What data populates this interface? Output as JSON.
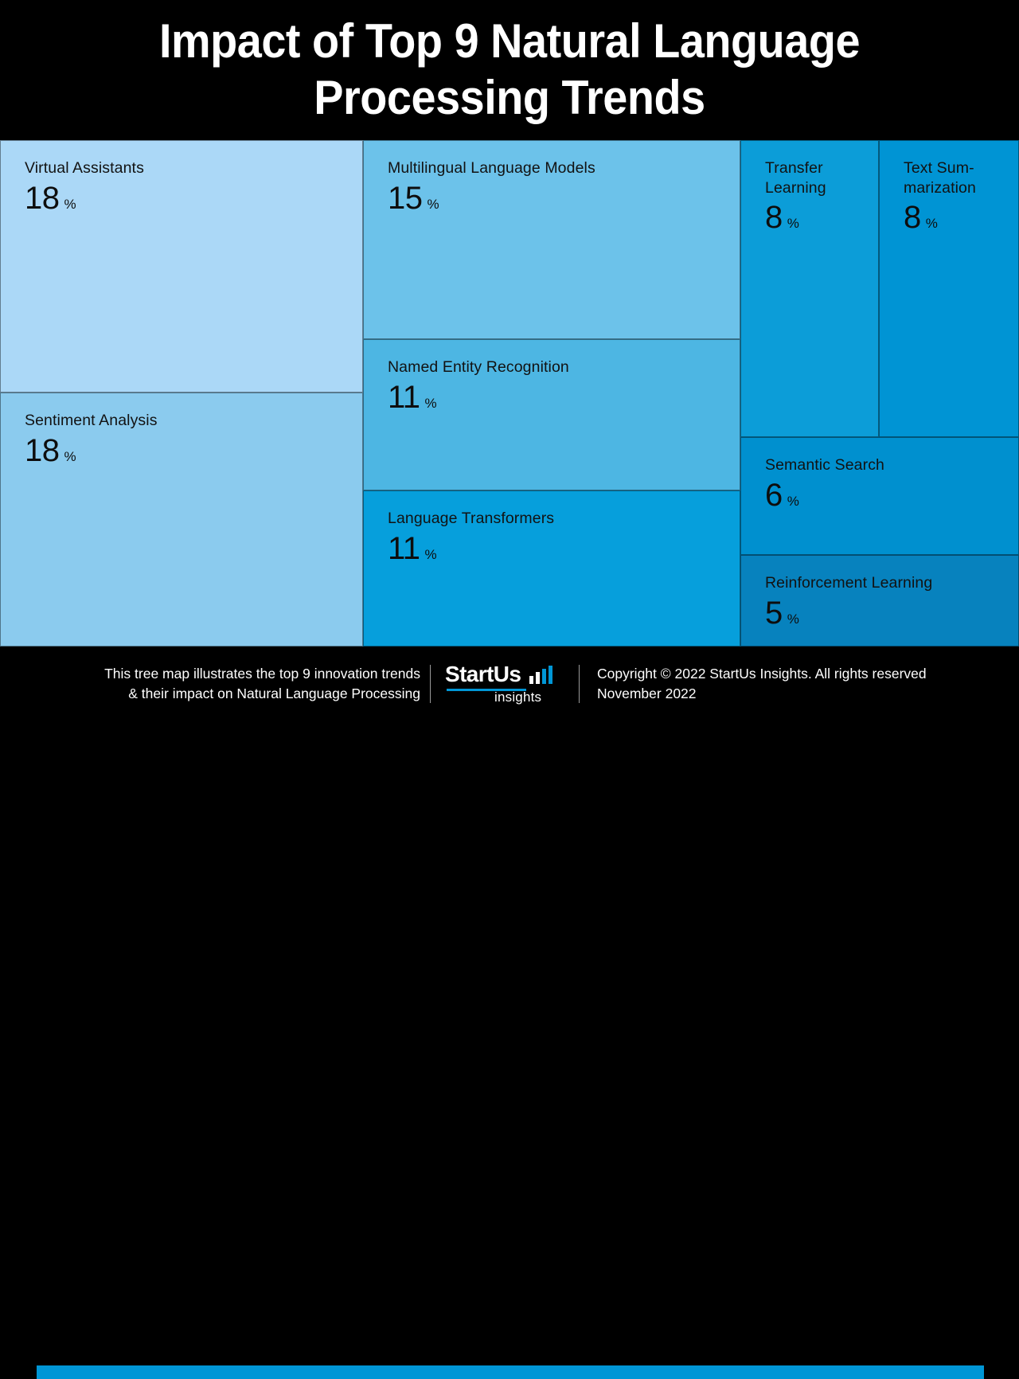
{
  "header": {
    "title": "Impact of Top 9 Natural Language\nProcessing Trends"
  },
  "footer": {
    "caption": "This tree map illustrates the top 9 innovation trends\n& their impact on Natural Language Processing",
    "copyright": "Copyright © 2022 StartUs Insights. All rights reserved\nNovember 2022",
    "logo_word": "StartUs",
    "logo_sub": "insights"
  },
  "unit": "%",
  "chart_data": {
    "type": "treemap",
    "title": "Impact of Top 9 Natural Language Processing Trends",
    "xlabel": "",
    "ylabel": "",
    "unit": "%",
    "legend": "none",
    "grid": false,
    "categories": [
      "Virtual Assistants",
      "Sentiment Analysis",
      "Multilingual Language Models",
      "Named Entity Recognition",
      "Language Transformers",
      "Transfer Learning",
      "Text Summarization",
      "Semantic Search",
      "Reinforcement Learning"
    ],
    "values": [
      18,
      18,
      15,
      11,
      11,
      8,
      8,
      6,
      5
    ],
    "cells": [
      {
        "label": "Virtual Assistants",
        "display_label": "Virtual Assistants",
        "value": 18,
        "color": "#ABD8F7"
      },
      {
        "label": "Sentiment Analysis",
        "display_label": "Sentiment Analysis",
        "value": 18,
        "color": "#8BCBEE"
      },
      {
        "label": "Multilingual Language Models",
        "display_label": "Multilingual Language Models",
        "value": 15,
        "color": "#6CC2EA"
      },
      {
        "label": "Named Entity Recognition",
        "display_label": "Named Entity Recognition",
        "value": 11,
        "color": "#4DB6E3"
      },
      {
        "label": "Language Transformers",
        "display_label": "Language Transformers",
        "value": 11,
        "color": "#069FDC"
      },
      {
        "label": "Transfer Learning",
        "display_label": "Transfer\nLearning",
        "value": 8,
        "color": "#0C9DD8"
      },
      {
        "label": "Text Summarization",
        "display_label": "Text Sum-\nmarization",
        "value": 8,
        "color": "#0094D4"
      },
      {
        "label": "Semantic Search",
        "display_label": "Semantic Search",
        "value": 6,
        "color": "#0090CF"
      },
      {
        "label": "Reinforcement Learning",
        "display_label": "Reinforcement Learning",
        "value": 5,
        "color": "#0782BE"
      }
    ]
  }
}
